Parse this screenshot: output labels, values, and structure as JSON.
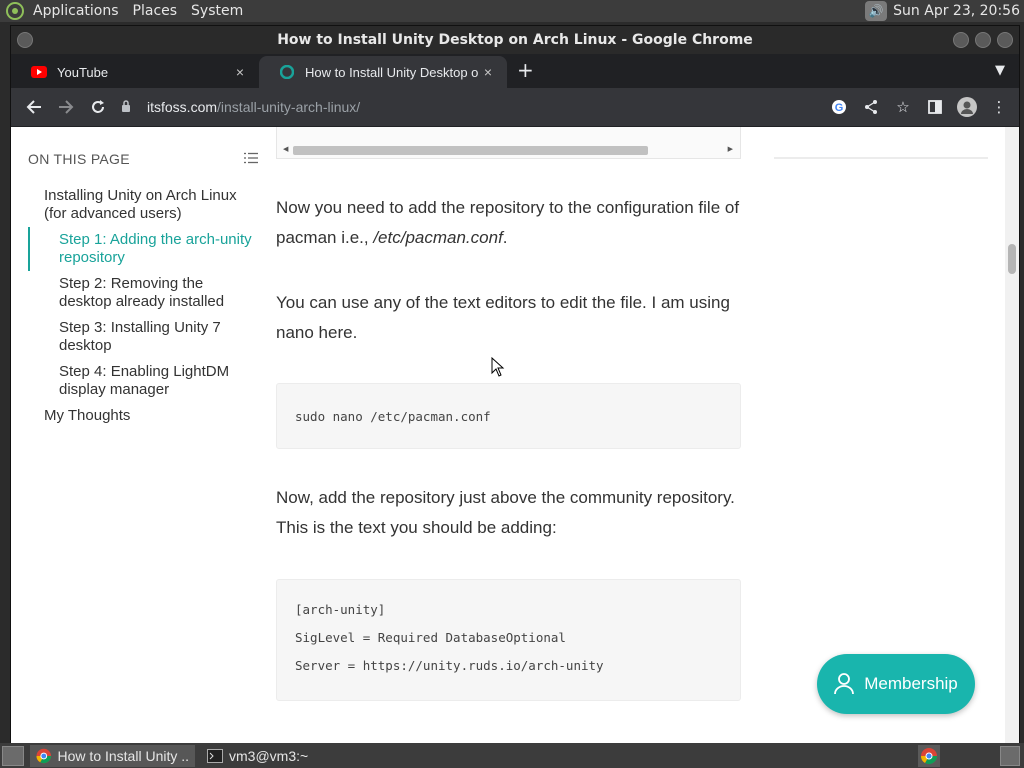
{
  "system_panel": {
    "menus": [
      "Applications",
      "Places",
      "System"
    ],
    "clock": "Sun Apr 23, 20:56"
  },
  "window": {
    "title": "How to Install Unity Desktop on Arch Linux - Google Chrome"
  },
  "tabs": [
    {
      "label": "YouTube",
      "close": "×"
    },
    {
      "label": "How to Install Unity Desktop on Arch Linux",
      "close": "×"
    }
  ],
  "new_tab": "+",
  "address_bar": {
    "domain": "itsfoss.com",
    "path": "/install-unity-arch-linux/"
  },
  "toc": {
    "heading": "ON THIS PAGE",
    "items": [
      {
        "label": "Installing Unity on Arch Linux (for advanced users)",
        "level": 1
      },
      {
        "label": "Step 1: Adding the arch-unity repository",
        "level": 2,
        "active": true
      },
      {
        "label": "Step 2: Removing the desktop already installed",
        "level": 2
      },
      {
        "label": "Step 3: Installing Unity 7 desktop",
        "level": 2
      },
      {
        "label": "Step 4: Enabling LightDM display manager",
        "level": 2
      },
      {
        "label": "My Thoughts",
        "level": 1
      }
    ]
  },
  "article": {
    "para1_text": "Now you need to add the repository to the configuration file of pacman i.e., ",
    "para1_em": "/etc/pacman.conf",
    "para1_end": ".",
    "para2": "You can use any of the text editors to edit the file. I am using nano here.",
    "code1": "sudo nano /etc/pacman.conf",
    "para3": "Now, add the repository just above the community repository. This is the text you should be adding:",
    "code2": [
      "[arch-unity]",
      "SigLevel = Required DatabaseOptional",
      "Server = https://unity.ruds.io/arch-unity"
    ]
  },
  "membership_button": "Membership",
  "taskbar": {
    "items": [
      {
        "label": "How to Install Unity ...",
        "active": true
      },
      {
        "label": "vm3@vm3:~",
        "active": false
      }
    ]
  },
  "colors": {
    "accent": "#19a39a",
    "membership": "#19b5ad"
  }
}
